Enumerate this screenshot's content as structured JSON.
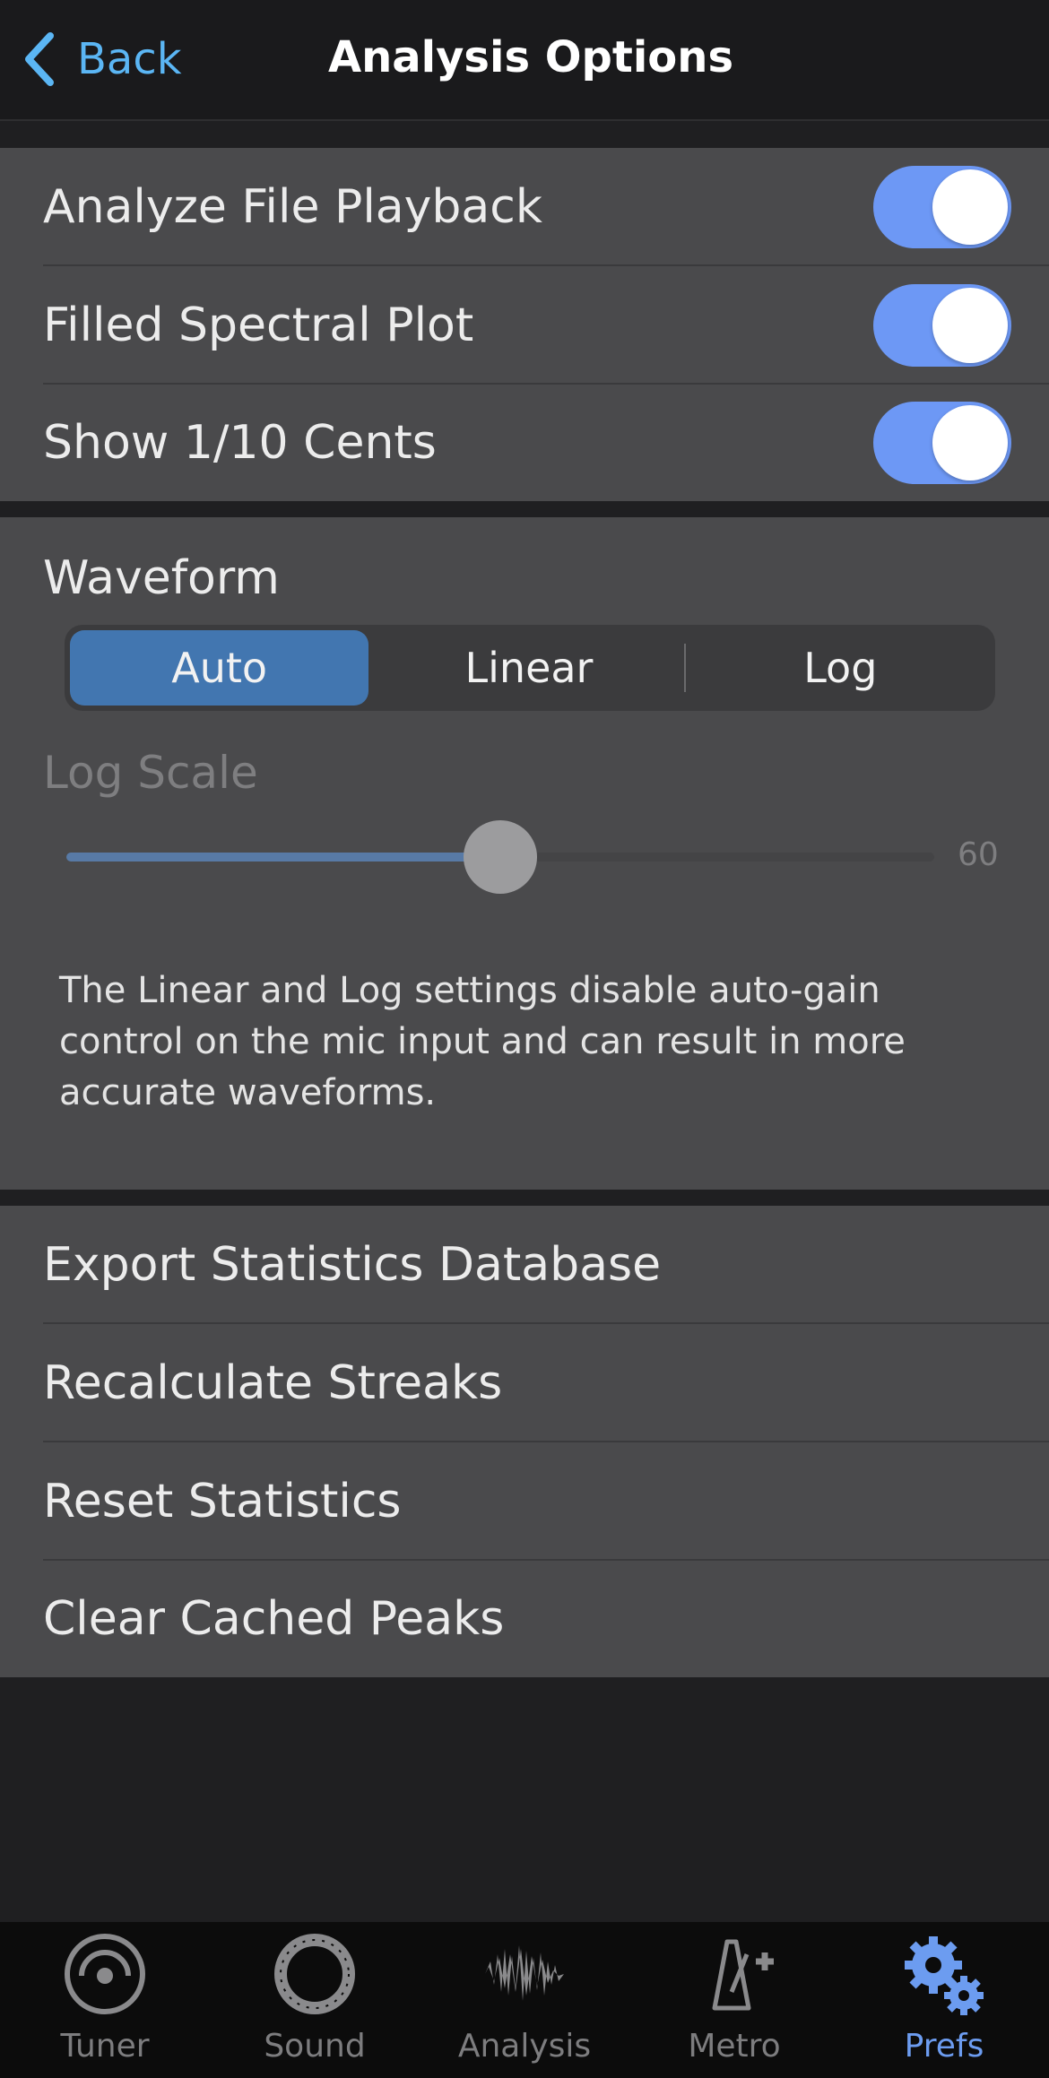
{
  "nav": {
    "back_label": "Back",
    "title": "Analysis Options"
  },
  "toggles": [
    {
      "label": "Analyze File Playback",
      "on": true
    },
    {
      "label": "Filled Spectral Plot",
      "on": true
    },
    {
      "label": "Show 1/10 Cents",
      "on": true
    }
  ],
  "waveform": {
    "title": "Waveform",
    "options": [
      "Auto",
      "Linear",
      "Log"
    ],
    "selected": "Auto",
    "log_scale_label": "Log Scale",
    "log_scale_value": "60",
    "log_scale_fraction": 0.5,
    "info": "The Linear and Log settings disable auto-gain control on the mic input and can result in more accurate waveforms."
  },
  "actions": [
    "Export Statistics Database",
    "Recalculate Streaks",
    "Reset Statistics",
    "Clear Cached Peaks"
  ],
  "tabs": [
    {
      "label": "Tuner",
      "icon": "tuner-icon"
    },
    {
      "label": "Sound",
      "icon": "sound-icon"
    },
    {
      "label": "Analysis",
      "icon": "waveform-icon"
    },
    {
      "label": "Metro",
      "icon": "metronome-icon"
    },
    {
      "label": "Prefs",
      "icon": "gears-icon",
      "active": true
    }
  ],
  "colors": {
    "accent": "#5bb6f4",
    "toggle_on": "#6d98f5",
    "segment_active": "#4276b0",
    "tab_active": "#6c9cf0"
  }
}
